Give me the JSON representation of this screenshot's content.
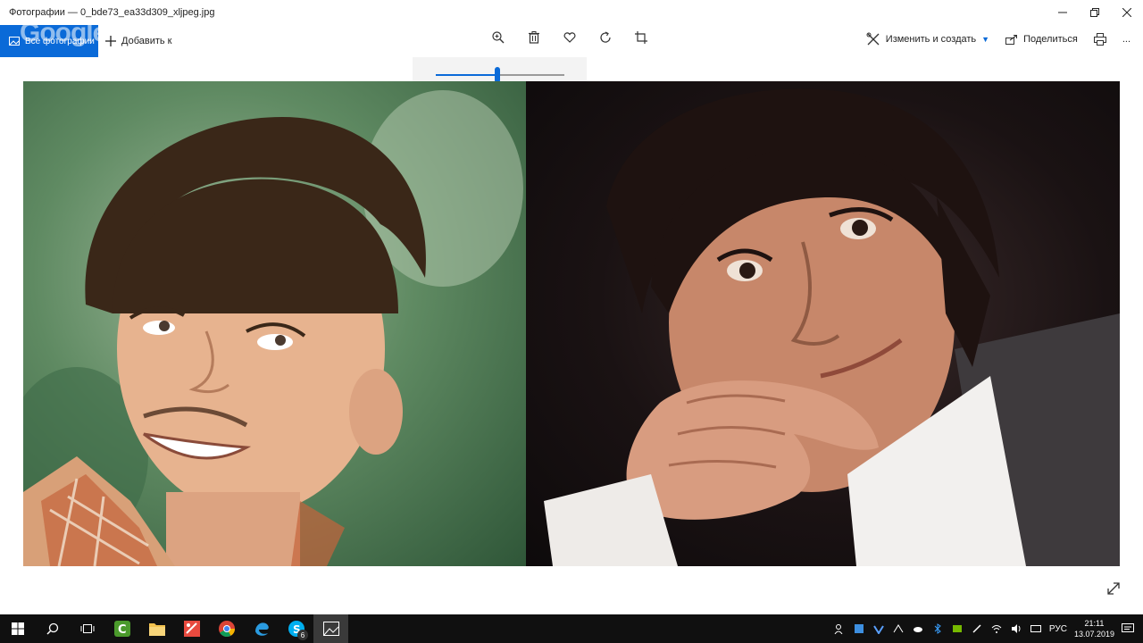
{
  "window": {
    "title": "Фотографии — 0_bde73_ea33d309_xljpeg.jpg"
  },
  "toolbar": {
    "all_photos_label": "Все фотографии",
    "watermark": "Google",
    "add_label": "Добавить к",
    "edit_create_label": "Изменить и создать",
    "share_label": "Поделиться",
    "more_label": "..."
  },
  "zoom": {
    "level": 0.48
  },
  "taskbar": {
    "skype_badge": "6",
    "language": "РУС",
    "time": "21:11",
    "date": "13.07.2019"
  },
  "colors": {
    "accent": "#0a6ad8",
    "taskbar": "#101010"
  },
  "icons": {
    "zoom": "zoom-in-icon",
    "delete": "trash-icon",
    "favorite": "heart-icon",
    "rotate": "rotate-icon",
    "crop": "crop-icon",
    "print": "print-icon",
    "expand": "expand-icon"
  }
}
